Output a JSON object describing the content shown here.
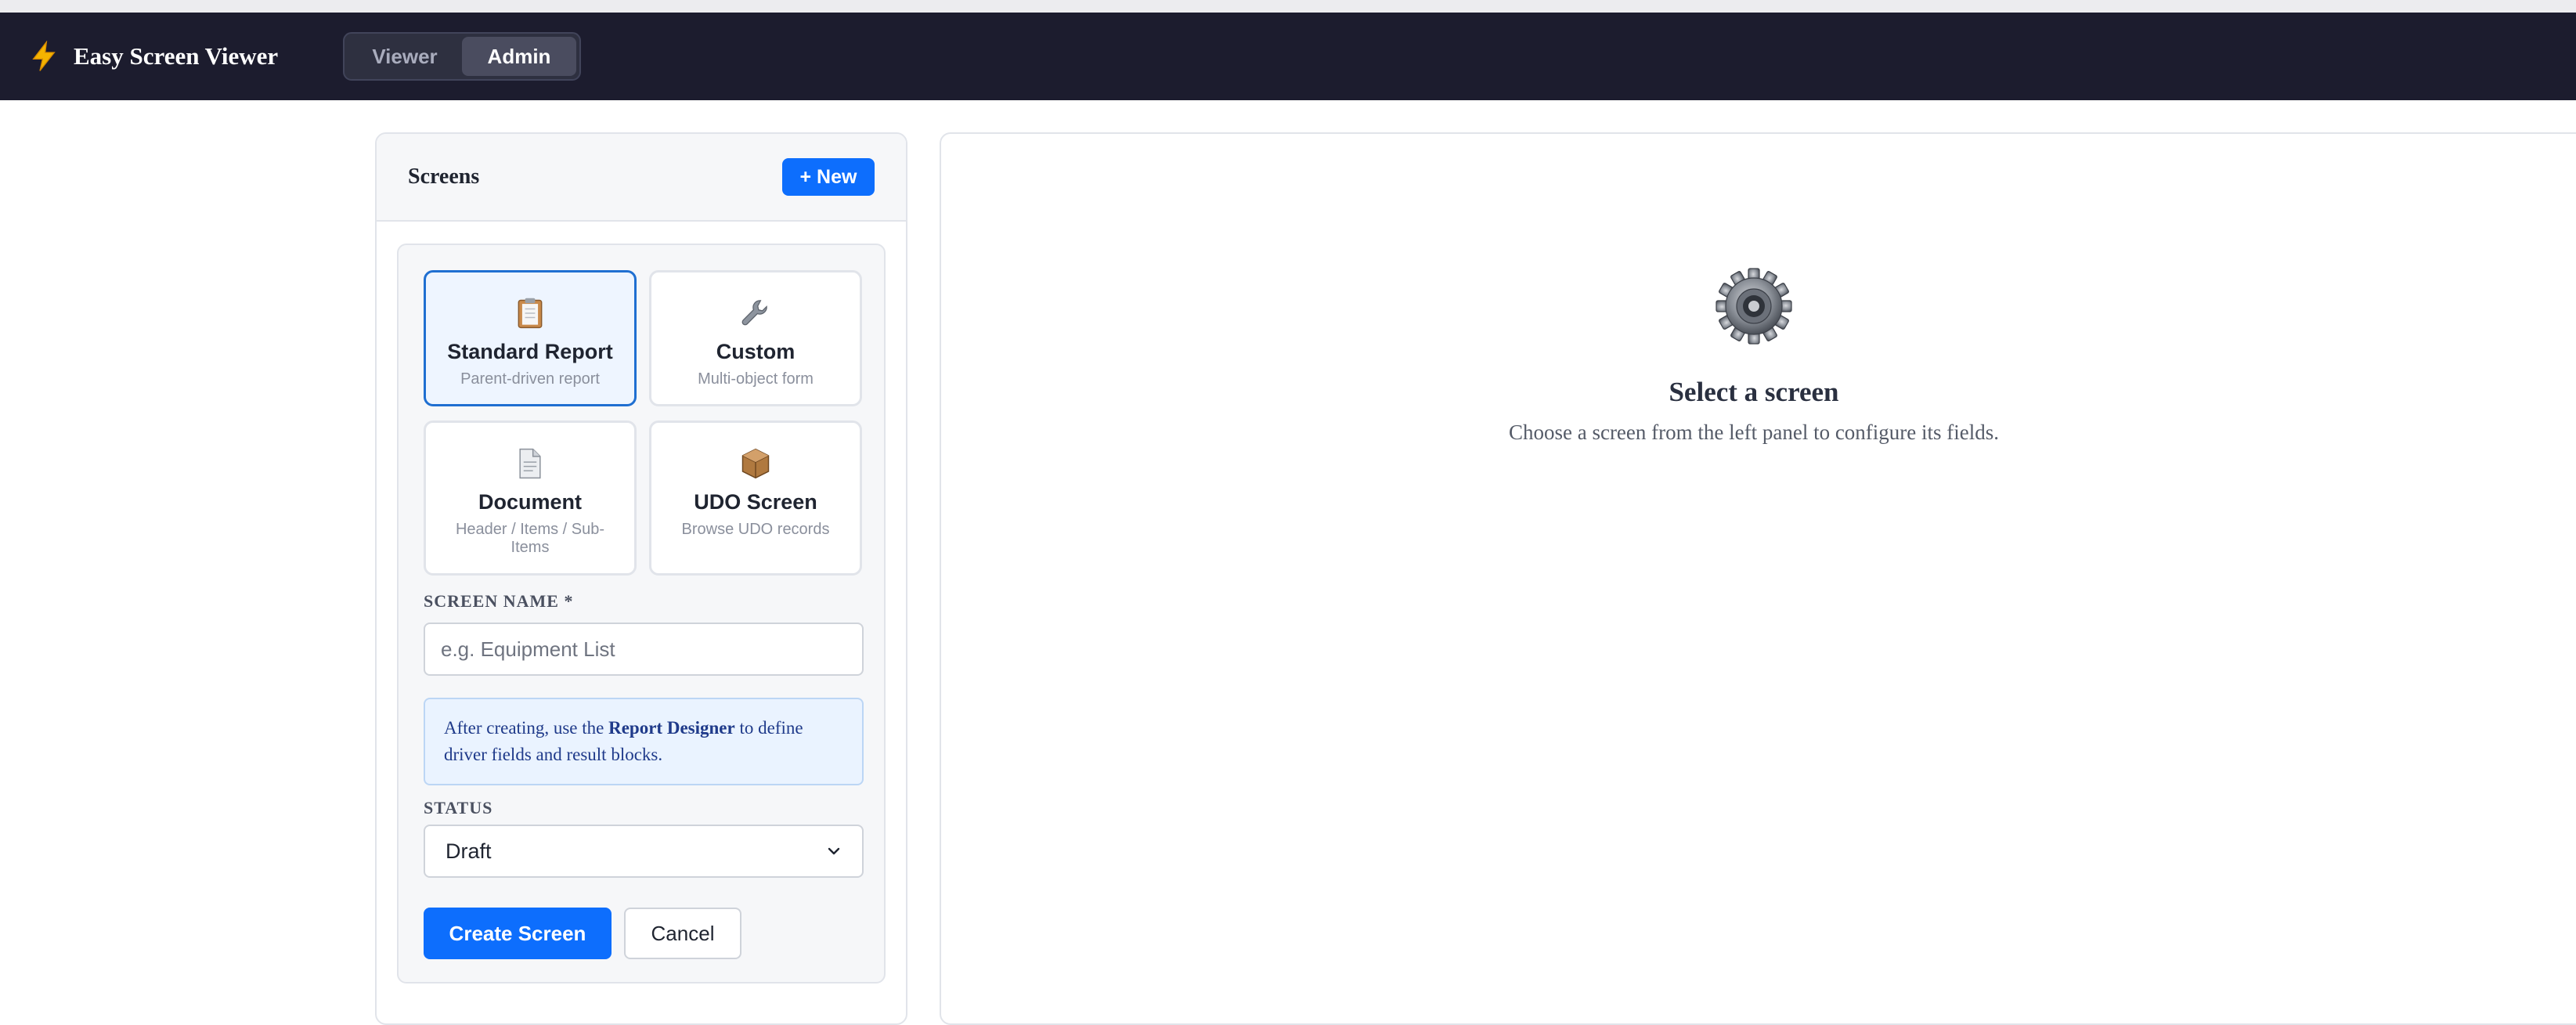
{
  "app": {
    "title": "Easy Screen Viewer",
    "modes": [
      "Viewer",
      "Admin"
    ],
    "active_mode": "Admin"
  },
  "sidebar": {
    "title": "Screens",
    "new_label": "+ New",
    "types": [
      {
        "name": "Standard Report",
        "desc": "Parent-driven report",
        "icon": "clipboard-icon",
        "selected": true
      },
      {
        "name": "Custom",
        "desc": "Multi-object form",
        "icon": "wrench-icon",
        "selected": false
      },
      {
        "name": "Document",
        "desc": "Header / Items / Sub-Items",
        "icon": "document-icon",
        "selected": false
      },
      {
        "name": "UDO Screen",
        "desc": "Browse UDO records",
        "icon": "package-icon",
        "selected": false
      }
    ],
    "screen_name_label": "SCREEN NAME *",
    "screen_name_placeholder": "e.g. Equipment List",
    "info_prefix": "After creating, use the",
    "info_link": "Report Designer",
    "info_suffix": "to define driver fields and result blocks.",
    "status_label": "STATUS",
    "status_value": "Draft",
    "create_label": "Create Screen",
    "cancel_label": "Cancel"
  },
  "main": {
    "title": "Select a screen",
    "subtitle": "Choose a screen from the left panel to configure its fields.",
    "icon": "gear-icon"
  },
  "colors": {
    "navbar": "#1c1c2e",
    "accent": "#0d6efd",
    "selected_border": "#1f6fd1",
    "info_bg": "#eaf3ff"
  }
}
